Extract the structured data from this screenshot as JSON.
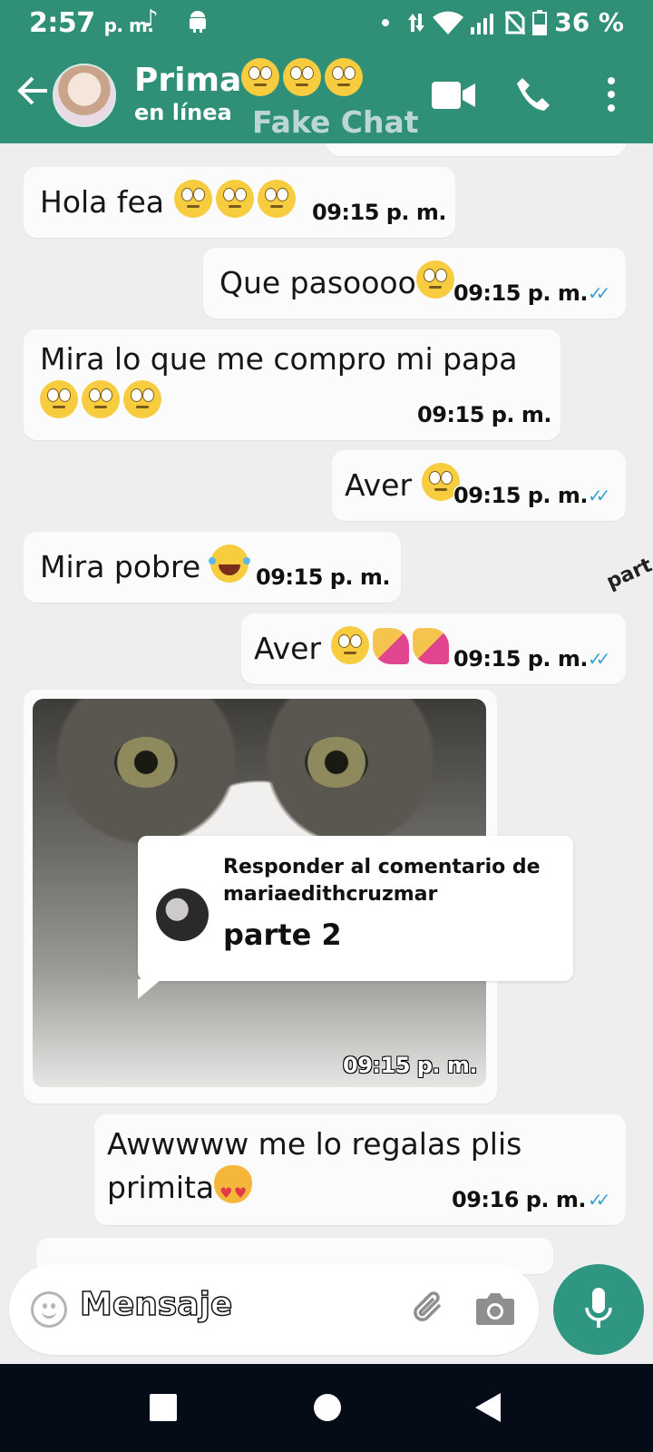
{
  "status_bar": {
    "time": "2:57",
    "ampm": "p. m.",
    "battery": "36 %"
  },
  "header": {
    "contact_name": "Prima",
    "contact_status": "en línea",
    "watermark": "Fake Chat"
  },
  "messages": [
    {
      "side": "in",
      "text": "Hola fea",
      "emoji": [
        "roll",
        "roll",
        "roll"
      ],
      "time": "09:15 p. m."
    },
    {
      "side": "out",
      "text": "Que pasoooo",
      "emoji": [
        "roll"
      ],
      "time": "09:15 p. m."
    },
    {
      "side": "in",
      "text": "Mira lo que me compro mi papa",
      "emoji": [
        "roll",
        "roll",
        "roll"
      ],
      "time": "09:15 p. m."
    },
    {
      "side": "out",
      "text": "Aver",
      "emoji": [
        "roll"
      ],
      "time": "09:15 p. m."
    },
    {
      "side": "in",
      "text": "Mira pobre",
      "emoji": [
        "laugh"
      ],
      "time": "09:15 p. m."
    },
    {
      "side": "out",
      "text": "Aver",
      "emoji": [
        "roll",
        "nails",
        "nails"
      ],
      "time": "09:15 p. m."
    },
    {
      "side": "in",
      "type": "image",
      "time": "09:15 p. m."
    },
    {
      "side": "out",
      "text": "Awwwww me lo regalas plis primita",
      "emoji": [
        "cat"
      ],
      "time": "09:16 p. m."
    }
  ],
  "reply_overlay": {
    "title": "Responder al comentario de mariaedithcruzmar",
    "text": "parte 2"
  },
  "side_text": "part",
  "input": {
    "placeholder": "Mensaje"
  },
  "colors": {
    "header": "#2f8f77",
    "mic": "#2f9681",
    "ticks": "#3aa2d2"
  }
}
